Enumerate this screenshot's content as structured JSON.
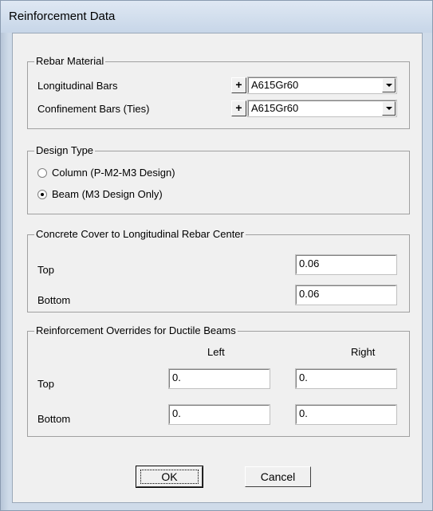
{
  "window": {
    "title": "Reinforcement Data"
  },
  "rebar_material": {
    "legend": "Rebar Material",
    "longitudinal": {
      "label": "Longitudinal Bars",
      "plus": "+",
      "value": "A615Gr60"
    },
    "confinement": {
      "label": "Confinement Bars (Ties)",
      "plus": "+",
      "value": "A615Gr60"
    }
  },
  "design_type": {
    "legend": "Design Type",
    "options": [
      {
        "label": "Column (P-M2-M3 Design)",
        "checked": false
      },
      {
        "label": "Beam (M3 Design Only)",
        "checked": true
      }
    ]
  },
  "concrete_cover": {
    "legend": "Concrete Cover to Longitudinal Rebar Center",
    "top_label": "Top",
    "top_value": "0.06",
    "bottom_label": "Bottom",
    "bottom_value": "0.06"
  },
  "overrides": {
    "legend": "Reinforcement Overrides for Ductile Beams",
    "col_left": "Left",
    "col_right": "Right",
    "top_label": "Top",
    "top_left": "0.",
    "top_right": "0.",
    "bottom_label": "Bottom",
    "bottom_left": "0.",
    "bottom_right": "0."
  },
  "buttons": {
    "ok": "OK",
    "cancel": "Cancel"
  }
}
